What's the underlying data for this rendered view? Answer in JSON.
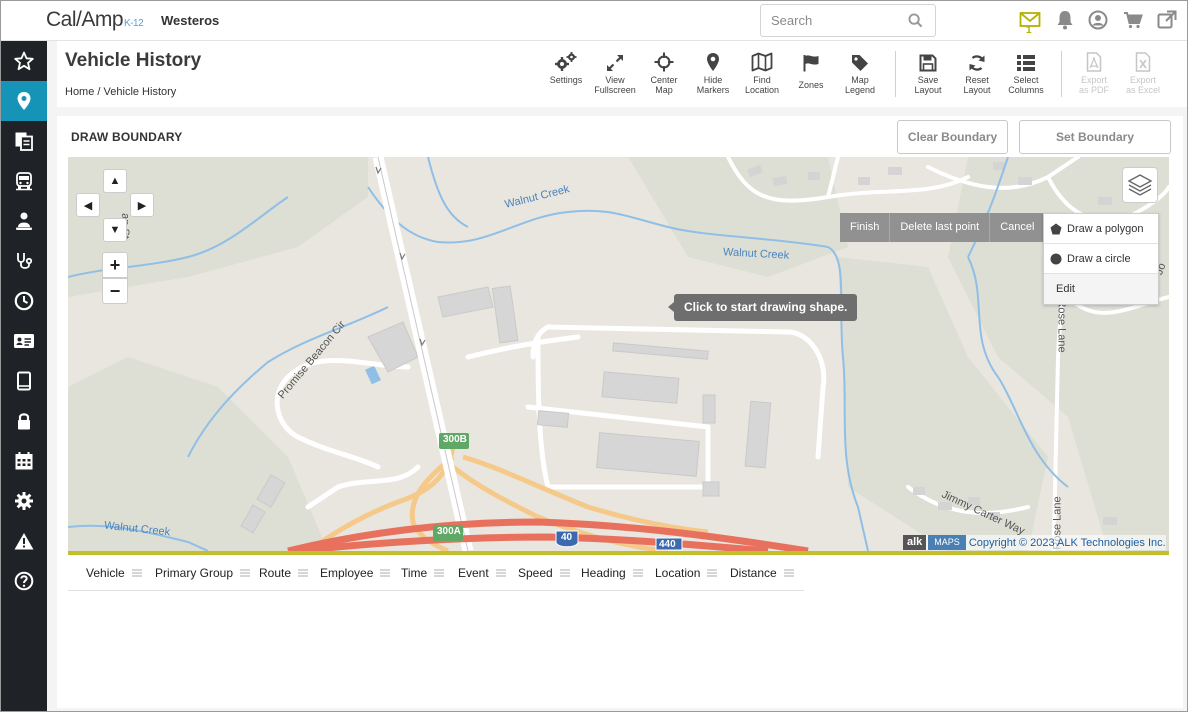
{
  "header": {
    "logo_text": "Cal/Amp",
    "logo_sub": "K-12",
    "org_name": "Westeros",
    "search_placeholder": "Search",
    "mail_count": "1",
    "icons": [
      "mail-icon",
      "bell-icon",
      "user-icon",
      "cart-icon",
      "external-link-icon"
    ]
  },
  "sidebar": {
    "items": [
      "star-icon",
      "map-pin-icon",
      "documents-icon",
      "bus-icon",
      "driver-icon",
      "stethoscope-icon",
      "clock-icon",
      "id-card-icon",
      "tablet-icon",
      "lock-icon",
      "calendar-icon",
      "gear-icon",
      "warning-icon",
      "help-icon"
    ],
    "active": "map-pin-icon"
  },
  "page": {
    "title": "Vehicle History",
    "breadcrumb_home": "Home",
    "breadcrumb_sep": "/",
    "breadcrumb_current": "Vehicle History"
  },
  "toolbar": {
    "settings": "Settings",
    "view_fullscreen_1": "View",
    "view_fullscreen_2": "Fullscreen",
    "center_map_1": "Center",
    "center_map_2": "Map",
    "hide_markers_1": "Hide",
    "hide_markers_2": "Markers",
    "find_location_1": "Find",
    "find_location_2": "Location",
    "zones": "Zones",
    "map_legend_1": "Map",
    "map_legend_2": "Legend",
    "save_layout_1": "Save",
    "save_layout_2": "Layout",
    "reset_layout_1": "Reset",
    "reset_layout_2": "Layout",
    "select_columns_1": "Select",
    "select_columns_2": "Columns",
    "export_pdf_1": "Export",
    "export_pdf_2": "as PDF",
    "export_excel_1": "Export",
    "export_excel_2": "as Excel"
  },
  "draw_boundary": {
    "title": "DRAW BOUNDARY",
    "clear_label": "Clear Boundary",
    "set_label": "Set Boundary"
  },
  "map": {
    "actions": [
      "Finish",
      "Delete last point",
      "Cancel"
    ],
    "menu": {
      "polygon": "Draw a polygon",
      "circle": "Draw a circle",
      "edit": "Edit"
    },
    "tooltip": "Click to start drawing shape.",
    "alk": "alk",
    "maps_tag": "MAPS",
    "copyright": "Copyright © 2023 ALK Technologies Inc.",
    "labels": {
      "walnut_creek_1": "Walnut Creek",
      "walnut_creek_2": "Walnut Creek",
      "walnut_creek_3": "Walnut Creek",
      "promise_beacon": "Promise Beacon Cir",
      "rose_lane_1": "Rose Lane",
      "rose_lane_2": "Rose Lane",
      "jimmy_carter": "Jimmy Carter Way",
      "an_st": "an St",
      "jo": "Jo",
      "exit_300b": "300B",
      "exit_300a": "300A",
      "i40": "40",
      "i440": "440"
    },
    "colors": {
      "water": "#8fbfe6",
      "interstate": "#e8715e",
      "ramp": "#f5c98a",
      "building": "#d6d6d6",
      "land": "#e9e6df",
      "accent_line": "#c3bf2a"
    }
  },
  "grid": {
    "columns": [
      "Vehicle",
      "Primary Group",
      "Route",
      "Employee",
      "Time",
      "Event",
      "Speed",
      "Heading",
      "Location",
      "Distance"
    ]
  }
}
